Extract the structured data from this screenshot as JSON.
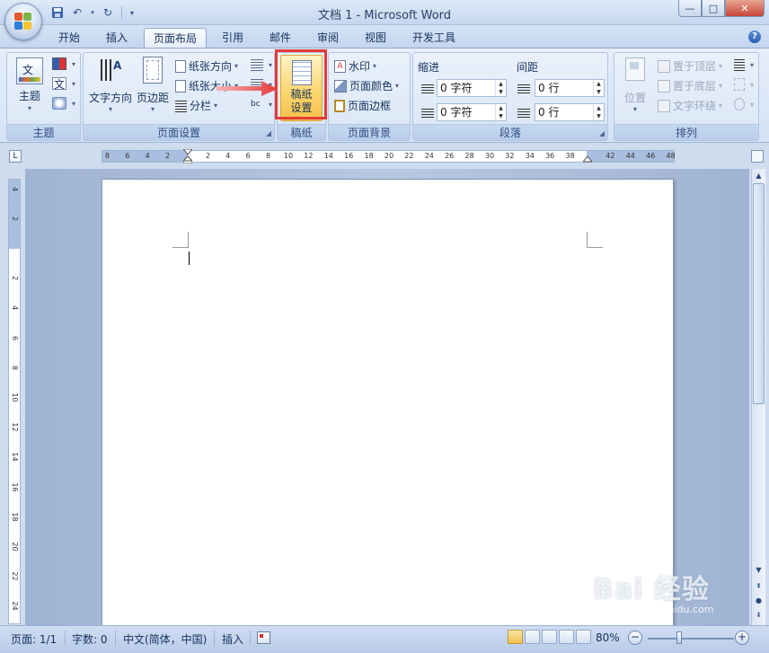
{
  "window": {
    "title": "文档 1 - Microsoft Word",
    "controls": {
      "minimize": "—",
      "maximize": "□",
      "close": "✕"
    }
  },
  "tabs": [
    {
      "label": "开始",
      "active": false
    },
    {
      "label": "插入",
      "active": false
    },
    {
      "label": "页面布局",
      "active": true
    },
    {
      "label": "引用",
      "active": false
    },
    {
      "label": "邮件",
      "active": false
    },
    {
      "label": "审阅",
      "active": false
    },
    {
      "label": "视图",
      "active": false
    },
    {
      "label": "开发工具",
      "active": false
    }
  ],
  "ribbon": {
    "theme": {
      "label": "主题",
      "btn_theme": "主题",
      "colors_icon": "color-palette-icon",
      "fonts_glyph": "文",
      "effects_icon": "effects-icon"
    },
    "page_setup": {
      "label": "页面设置",
      "text_direction": "文字方向",
      "margins": "页边距",
      "orientation": "纸张方向",
      "size": "纸张大小",
      "columns": "分栏"
    },
    "manuscript": {
      "label": "稿纸",
      "btn_line1": "稿纸",
      "btn_line2": "设置"
    },
    "page_background": {
      "label": "页面背景",
      "watermark": "水印",
      "page_color": "页面颜色",
      "page_borders": "页面边框"
    },
    "paragraph": {
      "label": "段落",
      "indent_title": "缩进",
      "spacing_title": "间距",
      "indent_left": "0 字符",
      "indent_right": "0 字符",
      "spacing_before": "0 行",
      "spacing_after": "0 行"
    },
    "arrange": {
      "label": "排列",
      "position": "位置",
      "bring_front": "置于顶层",
      "send_back": "置于底层",
      "text_wrap": "文字环绕"
    }
  },
  "ruler": {
    "ticks": [
      "8",
      "6",
      "4",
      "2",
      "2",
      "4",
      "6",
      "8",
      "10",
      "12",
      "14",
      "16",
      "18",
      "20",
      "22",
      "24",
      "26",
      "28",
      "30",
      "32",
      "34",
      "36",
      "38",
      "42",
      "44",
      "46",
      "48"
    ],
    "vticks": [
      "4",
      "2",
      "2",
      "4",
      "6",
      "8",
      "10",
      "12",
      "14",
      "16",
      "18",
      "20",
      "22",
      "24"
    ]
  },
  "statusbar": {
    "page": "页面: 1/1",
    "words": "字数: 0",
    "language": "中文(简体，中国)",
    "mode": "插入",
    "zoom": "80%"
  },
  "watermark": {
    "text": "Bai 经验",
    "sub": "jingyan.baidu.com"
  },
  "colors": {
    "highlight": "#e23b3b",
    "accent": "#2b5fb0"
  }
}
